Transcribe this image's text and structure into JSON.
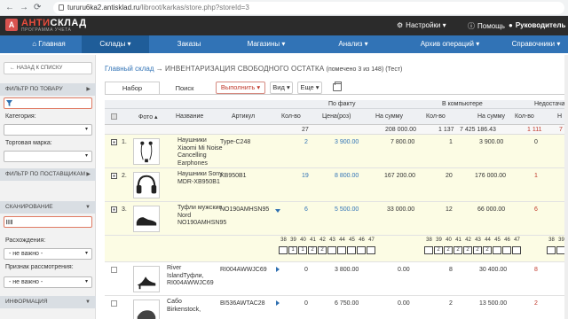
{
  "browser": {
    "url_host": "tururu6ka2.antisklad.ru",
    "url_path": "/libroot/karkas/store.php?storeId=3"
  },
  "app": {
    "logo_a": "АНТИ",
    "logo_b": "СКЛАД",
    "logo_sub": "ПРОГРАММА УЧЕТА",
    "settings": "Настройки",
    "help": "Помощь",
    "user": "Руководитель"
  },
  "nav": [
    "Главная",
    "Склады",
    "Заказы",
    "Магазины",
    "Анализ",
    "Архив операций",
    "Справочники"
  ],
  "sidebar": {
    "back": "← НАЗАД К СПИСКУ",
    "filter_product": "ФИЛЬТР ПО ТОВАРУ",
    "category_label": "Категория:",
    "brand_label": "Торговая марка:",
    "filter_supplier": "ФИЛЬТР ПО ПОСТАВЩИКАМ",
    "scan": "СКАНИРОВАНИЕ",
    "discrepancy_label": "Расхождения:",
    "discrepancy_value": "- не важно -",
    "review_label": "Признак рассмотрения:",
    "review_value": "- не важно -",
    "info": "ИНФОРМАЦИЯ"
  },
  "crumb": {
    "link": "Главный склад",
    "sep": "→",
    "title": "ИНВЕНТАРИЗАЦИЯ СВОБОДНОГО ОСТАТКА",
    "meta": "(помечено 3 из 148) (Тест)"
  },
  "tabs": [
    "Набор",
    "Поиск"
  ],
  "toolbar": {
    "execute": "Выполнить",
    "view": "Вид",
    "more": "Еще"
  },
  "table": {
    "groups": {
      "fact": "По факту",
      "computer": "В компьютере",
      "shortage": "Недостача"
    },
    "cols": [
      "Фото",
      "Название",
      "Артикул",
      "Кол-во",
      "Цена(роз)",
      "На сумму",
      "Кол-во",
      "На сумму",
      "Кол-во",
      "Н"
    ],
    "totals": {
      "fact_qty": "27",
      "fact_sum": "208 000.00",
      "comp_qty": "1 137",
      "comp_sum": "7 425 186.43",
      "short_qty": "1 111",
      "short_sum": "7 2"
    },
    "rows": [
      {
        "n": "1.",
        "name": [
          "Наушники",
          "Xiaomi Mi Noise",
          "Cancelling",
          "Earphones"
        ],
        "sku": "Type-C248",
        "qty": "2",
        "price": "3 900.00",
        "sum": "7 800.00",
        "cqty": "1",
        "csum": "3 900.00",
        "sqty": "0",
        "ssum": "",
        "checked": true
      },
      {
        "n": "2.",
        "name": [
          "Наушники Sony",
          "MDR-XB950B1"
        ],
        "sku": "XB950B1",
        "qty": "19",
        "price": "8 800.00",
        "sum": "167 200.00",
        "cqty": "20",
        "csum": "176 000.00",
        "sqty": "1",
        "ssum": "",
        "checked": true
      },
      {
        "n": "3.",
        "name": [
          "Туфли мужские",
          "Nord",
          "NO190AMHSN95"
        ],
        "sku": "NO190AMHSN95",
        "qty": "6",
        "price": "5 500.00",
        "sum": "33 000.00",
        "cqty": "12",
        "csum": "66 000.00",
        "sqty": "6",
        "ssum": "",
        "checked": true
      },
      {
        "n": "",
        "name": [
          "River",
          "IslandТуфли,",
          "RI004AWWJC69"
        ],
        "sku": "RI004AWWJC69",
        "qty": "0",
        "price": "3 800.00",
        "sum": "0.00",
        "cqty": "8",
        "csum": "30 400.00",
        "sqty": "8",
        "ssum": "",
        "checked": false
      },
      {
        "n": "",
        "name": [
          "Сабо",
          "Birkenstock,"
        ],
        "sku": "BI536AWTAC28",
        "qty": "0",
        "price": "6 750.00",
        "sum": "0.00",
        "cqty": "2",
        "csum": "13 500.00",
        "sqty": "2",
        "ssum": "",
        "checked": false
      }
    ],
    "sizes_left": [
      "38",
      "39",
      "40",
      "41",
      "42",
      "43",
      "44",
      "45",
      "46",
      "47"
    ],
    "sizes_left_vals": [
      "",
      "1",
      "1",
      "2",
      "2",
      "",
      "",
      "",
      "",
      ""
    ],
    "sizes_right": [
      "38",
      "39",
      "40",
      "41",
      "42",
      "43",
      "44",
      "45",
      "46",
      "47"
    ],
    "sizes_right_vals": [
      "",
      "2",
      "2",
      "2",
      "2",
      "2",
      "2",
      "",
      "",
      ""
    ],
    "sizes_far": [
      "38",
      "39"
    ],
    "sizes_far_vals": [
      "",
      ""
    ]
  }
}
